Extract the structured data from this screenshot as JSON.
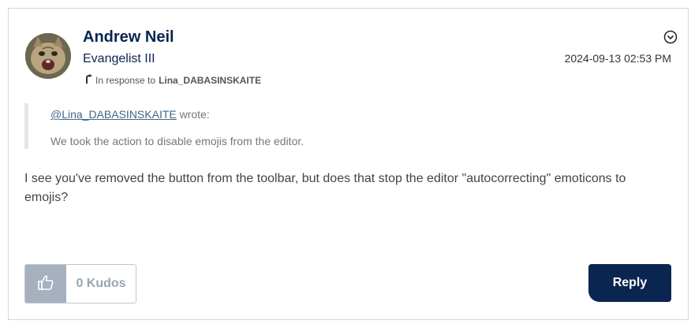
{
  "post": {
    "author": {
      "name": "Andrew Neil",
      "rank": "Evangelist III"
    },
    "in_response_prefix": "In response to",
    "in_response_to": "Lina_DABASINSKAITE",
    "timestamp": "2024-09-13 02:53 PM",
    "quote": {
      "mention": "@Lina_DABASINSKAITE",
      "wrote": " wrote:",
      "text": "We took the action to disable emojis from the editor."
    },
    "body": "I see you've removed the button from the toolbar, but does that stop the editor \"autocorrecting\" emoticons to emojis?"
  },
  "actions": {
    "kudos_label": "0 Kudos",
    "reply_label": "Reply"
  },
  "colors": {
    "brand_navy": "#0b2551",
    "kudo_button_bg": "#a6b0bf"
  },
  "icons": {
    "options": "chevron-circle-down-icon",
    "kudo": "thumbs-up-icon",
    "in_response": "reply-arrow-icon"
  }
}
